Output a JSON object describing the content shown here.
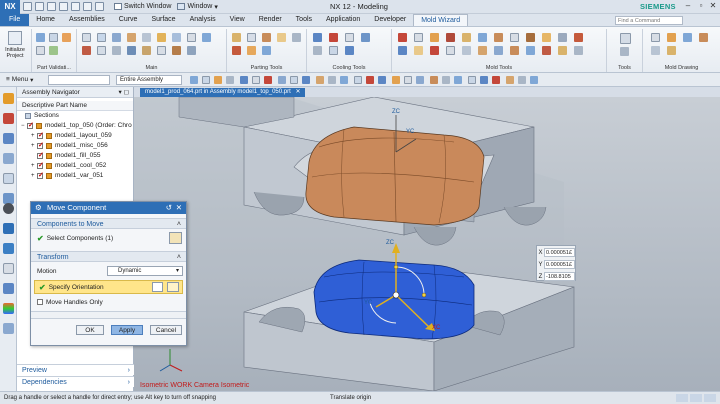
{
  "titlebar": {
    "logo": "NX",
    "switch_window": "Switch Window",
    "window_menu": "Window",
    "title": "NX 12 - Modeling",
    "brand": "SIEMENS"
  },
  "tabs": [
    "File",
    "Home",
    "Assemblies",
    "Curve",
    "Surface",
    "Analysis",
    "View",
    "Render",
    "Tools",
    "Application",
    "Developer",
    "Mold Wizard"
  ],
  "find_command_placeholder": "Find a Command",
  "ribbon": {
    "initialize_label": "Initialize Project",
    "groups": [
      "Part Validati...",
      "Main",
      "Parting Tools",
      "Cooling Tools",
      "Mold Tools",
      "Tools",
      "Mold Drawing"
    ]
  },
  "selbar": {
    "menu_label": "Menu",
    "filter_value": "Entire Assembly"
  },
  "navigator": {
    "title": "Assembly Navigator",
    "column": "Descriptive Part Name",
    "items": [
      {
        "label": "Sections",
        "checked": false
      },
      {
        "label": "model1_top_050 (Order: Chro",
        "checked": true
      },
      {
        "label": "model1_layout_059",
        "checked": true
      },
      {
        "label": "model1_misc_056",
        "checked": true
      },
      {
        "label": "model1_fill_055",
        "checked": true
      },
      {
        "label": "model1_cool_052",
        "checked": true
      },
      {
        "label": "model1_var_051",
        "checked": true
      }
    ],
    "bottom": [
      "Preview",
      "Dependencies"
    ]
  },
  "graphics": {
    "tab_label": "model1_prod_064.prt in Assembly model1_top_050.prt",
    "view_label": "Isometric WORK Camera Isometric",
    "axis_zc": "ZC",
    "axis_yc": "YC",
    "axis_xc": "XC"
  },
  "xyz": {
    "x": "0.000051£",
    "y": "0.000051£",
    "z": "-108.8105"
  },
  "dialog": {
    "title": "Move Component",
    "section_components": "Components to Move",
    "select_components": "Select Components (1)",
    "section_transform": "Transform",
    "motion_label": "Motion",
    "motion_value": "Dynamic",
    "specify_orientation": "Specify Orientation",
    "move_handles_only": "Move Handles Only",
    "ok": "OK",
    "apply": "Apply",
    "cancel": "Cancel"
  },
  "status": {
    "left": "Drag a handle or select a handle for direct entry; use Alt key to turn off snapping",
    "center": "Translate origin"
  },
  "colors": {
    "nx_blue": "#2e6fb6",
    "mold_orange": "#c9895b",
    "mold_blue": "#2f5fd6",
    "highlight_yellow": "#ffe58a"
  }
}
